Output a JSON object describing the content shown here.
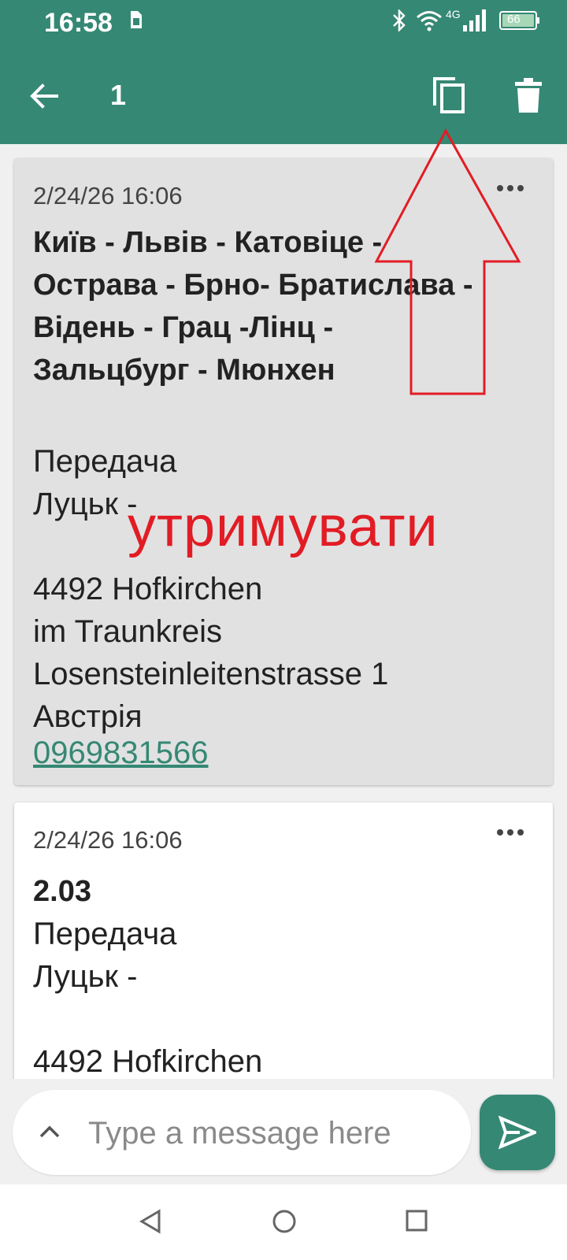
{
  "status_bar": {
    "time": "16:58",
    "network": "4G",
    "battery": "66"
  },
  "toolbar": {
    "selected_count": "1"
  },
  "messages": [
    {
      "timestamp": "2/24/26 16:06",
      "title": "Київ - Львів - Катовіце - Острава - Брно- Братислава - Відень - Грац -Лінц - Зальцбург - Мюнхен",
      "body": "Передача\nЛуцьк -\n\n4492 Hofkirchen\nim Traunkreis\nLosensteinleitenstrasse 1\nАвстрія",
      "phone": "0969831566",
      "selected": true
    },
    {
      "timestamp": "2/24/26 16:06",
      "title": "2.03",
      "body": "Передача\nЛуцьк -\n\n4492 Hofkirchen",
      "selected": false
    }
  ],
  "annotation": {
    "text": "утримувати",
    "color": "#e21c24"
  },
  "composer": {
    "placeholder": "Type a message here"
  },
  "colors": {
    "primary": "#358874",
    "selected_card": "#e1e1e1",
    "background": "#f0f0f0",
    "annotation": "#e21c24"
  },
  "icons": [
    "back-arrow-icon",
    "copy-icon",
    "trash-icon",
    "more-icon",
    "chevron-up-icon",
    "send-icon"
  ]
}
